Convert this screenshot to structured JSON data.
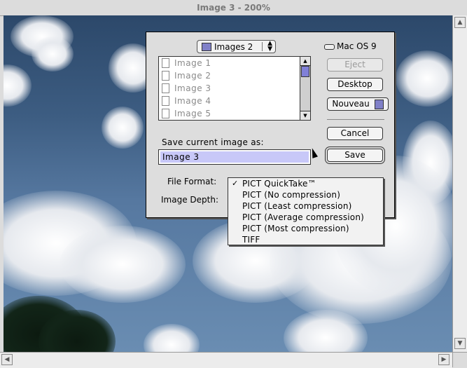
{
  "window": {
    "title": "Image  3 - 200%"
  },
  "dialog": {
    "folder_popup": {
      "label": "Images 2",
      "icon": "folder-icon"
    },
    "files": [
      {
        "name": "Image  1"
      },
      {
        "name": "Image  2"
      },
      {
        "name": "Image  3"
      },
      {
        "name": "Image  4"
      },
      {
        "name": "Image  5"
      }
    ],
    "disk": {
      "label": "Mac OS 9",
      "icon": "hard-disk-icon"
    },
    "buttons": {
      "eject": "Eject",
      "desktop": "Desktop",
      "nouveau": "Nouveau",
      "cancel": "Cancel",
      "save": "Save"
    },
    "save_label": "Save current image as:",
    "filename": "Image  3",
    "file_format_label": "File Format:",
    "image_depth_label": "Image Depth:"
  },
  "format_menu": {
    "selected": "PICT QuickTake™",
    "items": [
      "PICT QuickTake™",
      "PICT (No compression)",
      "PICT (Least compression)",
      "PICT (Average compression)",
      "PICT (Most compression)",
      "TIFF"
    ]
  },
  "colors": {
    "selection": "#c8c8f8",
    "scroll_thumb": "#8080d8"
  }
}
